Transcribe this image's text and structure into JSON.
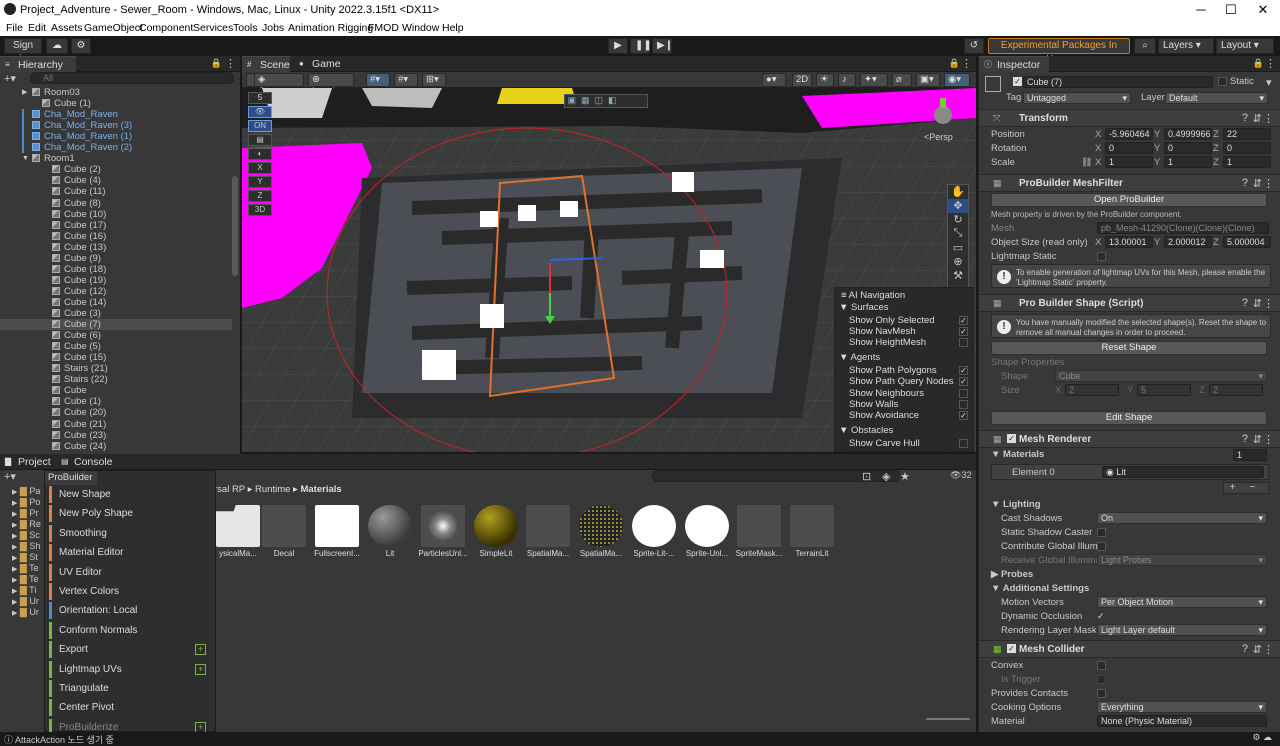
{
  "title_bar": {
    "title": "Project_Adventure - Sewer_Room - Windows, Mac, Linux - Unity 2022.3.15f1 <DX11>",
    "minimize": "─",
    "maximize": "☐",
    "close": "✕"
  },
  "menu": [
    "File",
    "Edit",
    "Assets",
    "GameObject",
    "Component",
    "Services",
    "Tools",
    "Jobs",
    "Animation Rigging",
    "FMOD",
    "Window",
    "Help"
  ],
  "toolbar": {
    "sign_in": "Sign in",
    "experimental": "Experimental Packages In Use ▾",
    "layers": "Layers",
    "layout": "Layout"
  },
  "hierarchy": {
    "tab": "Hierarchy",
    "search_placeholder": "All",
    "rows": [
      {
        "label": "Room03",
        "indent": 2,
        "fold": "▶",
        "kind": "room"
      },
      {
        "label": "Cube (1)",
        "indent": 2,
        "fold": "",
        "kind": "cube"
      },
      {
        "label": "Cha_Mod_Raven",
        "indent": 2,
        "fold": "",
        "kind": "prefab"
      },
      {
        "label": "Cha_Mod_Raven (3)",
        "indent": 2,
        "fold": "",
        "kind": "prefab"
      },
      {
        "label": "Cha_Mod_Raven (1)",
        "indent": 2,
        "fold": "",
        "kind": "prefab"
      },
      {
        "label": "Cha_Mod_Raven (2)",
        "indent": 2,
        "fold": "",
        "kind": "prefab"
      },
      {
        "label": "Room1",
        "indent": 2,
        "fold": "▼",
        "kind": "room"
      },
      {
        "label": "Cube (2)",
        "indent": 3,
        "kind": "cube"
      },
      {
        "label": "Cube (4)",
        "indent": 3,
        "kind": "cube"
      },
      {
        "label": "Cube (11)",
        "indent": 3,
        "kind": "cube"
      },
      {
        "label": "Cube (8)",
        "indent": 3,
        "kind": "cube"
      },
      {
        "label": "Cube (10)",
        "indent": 3,
        "kind": "cube"
      },
      {
        "label": "Cube (17)",
        "indent": 3,
        "kind": "cube"
      },
      {
        "label": "Cube (16)",
        "indent": 3,
        "kind": "cube"
      },
      {
        "label": "Cube (13)",
        "indent": 3,
        "kind": "cube"
      },
      {
        "label": "Cube (9)",
        "indent": 3,
        "kind": "cube"
      },
      {
        "label": "Cube (18)",
        "indent": 3,
        "kind": "cube"
      },
      {
        "label": "Cube (19)",
        "indent": 3,
        "kind": "cube"
      },
      {
        "label": "Cube (12)",
        "indent": 3,
        "kind": "cube"
      },
      {
        "label": "Cube (14)",
        "indent": 3,
        "kind": "cube"
      },
      {
        "label": "Cube (3)",
        "indent": 3,
        "kind": "cube"
      },
      {
        "label": "Cube (7)",
        "indent": 3,
        "kind": "cube",
        "selected": true
      },
      {
        "label": "Cube (6)",
        "indent": 3,
        "kind": "cube"
      },
      {
        "label": "Cube (5)",
        "indent": 3,
        "kind": "cube"
      },
      {
        "label": "Cube (15)",
        "indent": 3,
        "kind": "cube"
      },
      {
        "label": "Stairs (21)",
        "indent": 3,
        "kind": "cube"
      },
      {
        "label": "Stairs (22)",
        "indent": 3,
        "kind": "cube"
      },
      {
        "label": "Cube",
        "indent": 3,
        "kind": "cube"
      },
      {
        "label": "Cube (1)",
        "indent": 3,
        "kind": "cube"
      },
      {
        "label": "Cube (20)",
        "indent": 3,
        "kind": "cube"
      },
      {
        "label": "Cube (21)",
        "indent": 3,
        "kind": "cube"
      },
      {
        "label": "Cube (23)",
        "indent": 3,
        "kind": "cube"
      },
      {
        "label": "Cube (24)",
        "indent": 3,
        "kind": "cube"
      }
    ]
  },
  "scene": {
    "tab_scene": "Scene",
    "tab_game": "Game",
    "pivot": "Center",
    "space": "Local",
    "mode_2d": "2D",
    "persp": "<Persp",
    "gizmo_count": "5",
    "view_3d": "3D"
  },
  "ai_nav": {
    "title": "AI Navigation",
    "sections": [
      {
        "header": "Surfaces",
        "items": [
          {
            "label": "Show Only Selected",
            "checked": true
          },
          {
            "label": "Show NavMesh",
            "checked": true
          },
          {
            "label": "Show HeightMesh",
            "checked": false
          }
        ]
      },
      {
        "header": "Agents",
        "items": [
          {
            "label": "Show Path Polygons",
            "checked": true
          },
          {
            "label": "Show Path Query Nodes",
            "checked": true
          },
          {
            "label": "Show Neighbours",
            "checked": false
          },
          {
            "label": "Show Walls",
            "checked": false
          },
          {
            "label": "Show Avoidance",
            "checked": true
          }
        ]
      },
      {
        "header": "Obstacles",
        "items": [
          {
            "label": "Show Carve Hull",
            "checked": false
          }
        ]
      }
    ]
  },
  "project": {
    "tab_project": "Project",
    "tab_console": "Console",
    "breadcrumb": [
      "rsal RP",
      "Runtime",
      "Materials"
    ],
    "count": "32",
    "tree": [
      "Pa",
      "Po",
      "Pr",
      "Re",
      "Sc",
      "Sh",
      "St",
      "Te",
      "Te",
      "Ti",
      "Ur",
      "Ur"
    ],
    "assets": [
      "ysicalMa...",
      "Decal",
      "FullscreenI...",
      "Lit",
      "ParticlesUnl...",
      "SimpleLit",
      "SpatialMa...",
      "SpatialMa...",
      "Sprite-Lit-...",
      "Sprite-Unl...",
      "SpriteMask...",
      "TerrainLit"
    ]
  },
  "probuilder": {
    "title": "ProBuilder",
    "items": [
      {
        "label": "New Shape",
        "color": "#e08040",
        "plus": false
      },
      {
        "label": "New Poly Shape",
        "color": "#e08040",
        "plus": false
      },
      {
        "label": "Smoothing",
        "color": "#e08040",
        "plus": false
      },
      {
        "label": "Material Editor",
        "color": "#e08040",
        "plus": false
      },
      {
        "label": "UV Editor",
        "color": "#e08040",
        "plus": false
      },
      {
        "label": "Vertex Colors",
        "color": "#e08040",
        "plus": false
      },
      {
        "label": "Orientation: Local",
        "color": "#4a90d0",
        "plus": false
      },
      {
        "label": "Conform Normals",
        "color": "#7cb342",
        "plus": false
      },
      {
        "label": "Export",
        "color": "#7cb342",
        "plus": true
      },
      {
        "label": "Lightmap UVs",
        "color": "#7cb342",
        "plus": true
      },
      {
        "label": "Triangulate",
        "color": "#7cb342",
        "plus": false
      },
      {
        "label": "Center Pivot",
        "color": "#7cb342",
        "plus": false
      },
      {
        "label": "ProBuilderize",
        "color": "#7cb342",
        "plus": true
      }
    ]
  },
  "inspector": {
    "tab": "Inspector",
    "object_name": "Cube (7)",
    "static": "Static",
    "tag_label": "Tag",
    "tag": "Untagged",
    "layer_label": "Layer",
    "layer": "Default",
    "transform": {
      "title": "Transform",
      "position_label": "Position",
      "rotation_label": "Rotation",
      "scale_label": "Scale",
      "position": [
        "-5.960464",
        "0.4999966",
        "22"
      ],
      "rotation": [
        "0",
        "0",
        "0"
      ],
      "scale": [
        "1",
        "1",
        "1"
      ]
    },
    "meshfilter": {
      "title": "ProBuilder MeshFilter",
      "open_button": "Open ProBuilder",
      "note": "Mesh property is driven by the ProBuilder component.",
      "mesh_label": "Mesh",
      "mesh": "pb_Mesh-41290(Clone)(Clone)(Clone)",
      "size_label": "Object Size (read only)",
      "size": [
        "13.00001",
        "2.000012",
        "5.000004"
      ],
      "lightmap_label": "Lightmap Static",
      "help": "To enable generation of lightmap UVs for this Mesh, please enable the 'Lightmap Static' property."
    },
    "shape": {
      "title": "Pro Builder Shape (Script)",
      "help": "You have manually modified the selected shape(s). Reset the shape to remove all manual changes in order to proceed.",
      "reset": "Reset Shape",
      "props_label": "Shape Properties",
      "shape_label": "Shape",
      "shape": "Cube",
      "size_label": "Size",
      "size": [
        "2",
        "5",
        "2"
      ],
      "edit": "Edit Shape"
    },
    "renderer": {
      "title": "Mesh Renderer",
      "materials_label": "Materials",
      "materials_count": "1",
      "element_label": "Element 0",
      "element": "Lit",
      "lighting_label": "Lighting",
      "cast_label": "Cast Shadows",
      "cast": "On",
      "static_caster": "Static Shadow Caster",
      "contribute": "Contribute Global Illumi",
      "receive_label": "Receive Global Illuminat",
      "receive": "Light Probes",
      "probes_label": "Probes",
      "additional_label": "Additional Settings",
      "motion_label": "Motion Vectors",
      "motion": "Per Object Motion",
      "occlusion_label": "Dynamic Occlusion",
      "rendering_label": "Rendering Layer Mask",
      "rendering": "Light Layer default"
    },
    "collider": {
      "title": "Mesh Collider",
      "convex": "Convex",
      "trigger": "Is Trigger",
      "contacts": "Provides Contacts",
      "cooking_label": "Cooking Options",
      "cooking": "Everything",
      "material_label": "Material",
      "material": "None (Physic Material)"
    }
  },
  "status": {
    "text": "AttackAction 노드 생기 중"
  },
  "colors": {
    "accent": "#d08a2c",
    "selection": "#4d4d4d",
    "navmesh": "#ff00ff",
    "prefab_text": "#7ab0ea"
  }
}
